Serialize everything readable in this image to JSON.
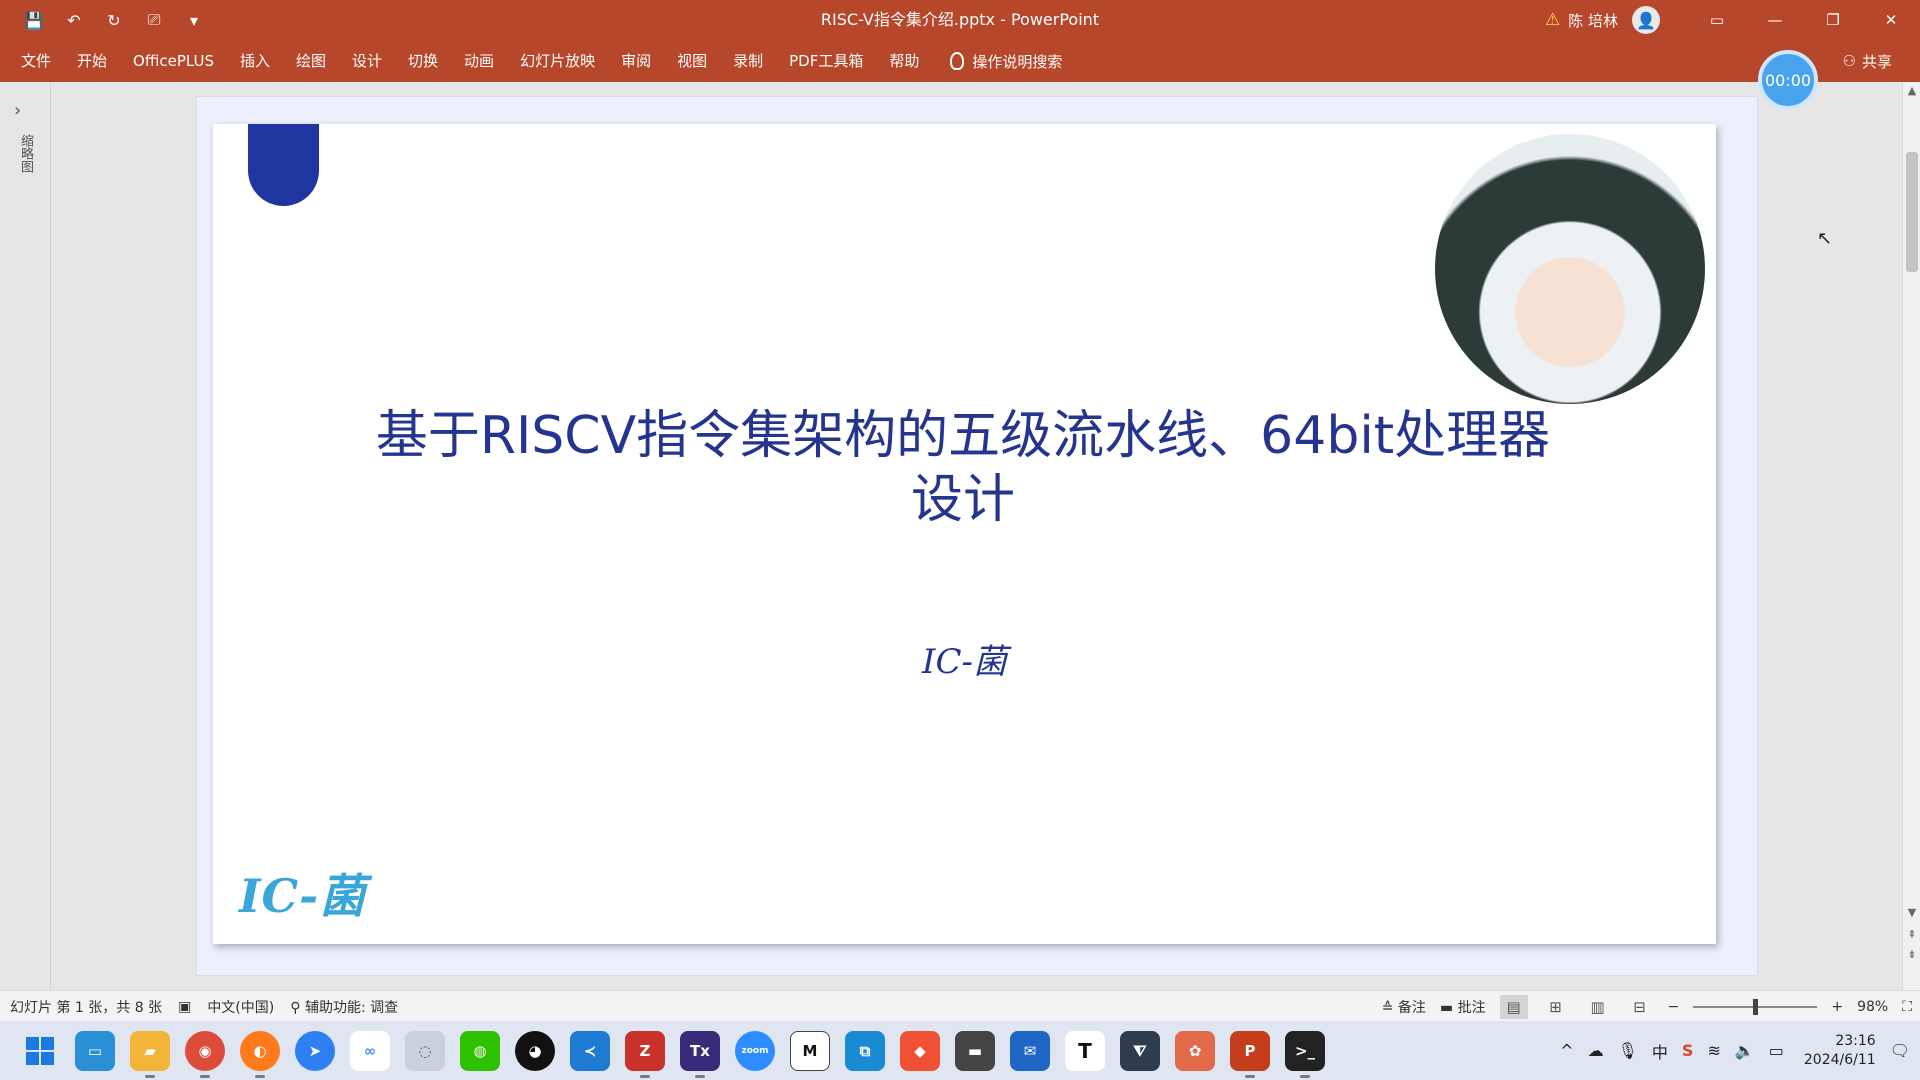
{
  "app": {
    "file_title": "RISC-V指令集介绍.pptx",
    "separator": " - ",
    "app_name": "PowerPoint",
    "user_name": "陈 培林"
  },
  "ribbon": {
    "tabs": [
      "文件",
      "开始",
      "OfficePLUS",
      "插入",
      "绘图",
      "设计",
      "切换",
      "动画",
      "幻灯片放映",
      "审阅",
      "视图",
      "录制",
      "PDF工具箱",
      "帮助"
    ],
    "tell_me": "操作说明搜索",
    "share": "共享"
  },
  "timer": "00:00",
  "thumb_pane_label": "缩略图",
  "slide": {
    "title": "基于RISCV指令集架构的五级流水线、64bit处理器设计",
    "subtitle": "IC-菌",
    "logo": "IC-菌"
  },
  "status": {
    "slide_info": "幻灯片 第 1 张，共 8 张",
    "language": "中文(中国)",
    "accessibility": "辅助功能: 调查",
    "notes": "备注",
    "comments": "批注",
    "zoom": "98%"
  },
  "taskbar": {
    "apps": [
      "start",
      "desktop",
      "file-explorer",
      "chrome",
      "firefox",
      "feishu",
      "baidu-netdisk",
      "unknown",
      "wechat",
      "qq",
      "vscode",
      "zotero",
      "texstudio",
      "zoom",
      "typora",
      "vmware",
      "git",
      "explorer-window",
      "outlook",
      "typora-t",
      "sourcetree",
      "xmind",
      "powerpoint",
      "terminal"
    ],
    "clock_time": "23:16",
    "clock_date": "2024/6/11",
    "ime": "中"
  },
  "colors": {
    "accent": "#b7472a",
    "title_blue": "#24348f",
    "logo_blue": "#3aa5d8",
    "timer_blue": "#4aa3ee"
  }
}
